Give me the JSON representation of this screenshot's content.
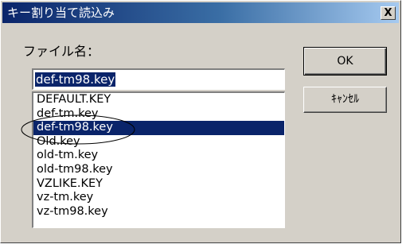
{
  "window": {
    "title": "キー割り当て読込み",
    "close_symbol": "X"
  },
  "form": {
    "filename_label": "ファイル名：",
    "filename_value": "def-tm98.key"
  },
  "file_list": {
    "items": [
      "DEFAULT.KEY",
      "def-tm.key",
      "def-tm98.key",
      "Old.key",
      "old-tm.key",
      "old-tm98.key",
      "VZLIKE.KEY",
      "vz-tm.key",
      "vz-tm98.key"
    ],
    "selected_index": 2
  },
  "buttons": {
    "ok_label": "OK",
    "cancel_label": "ｷｬﾝｾﾙ"
  },
  "colors": {
    "selection": "#0a246a",
    "dialog_face": "#d4d0c8"
  }
}
